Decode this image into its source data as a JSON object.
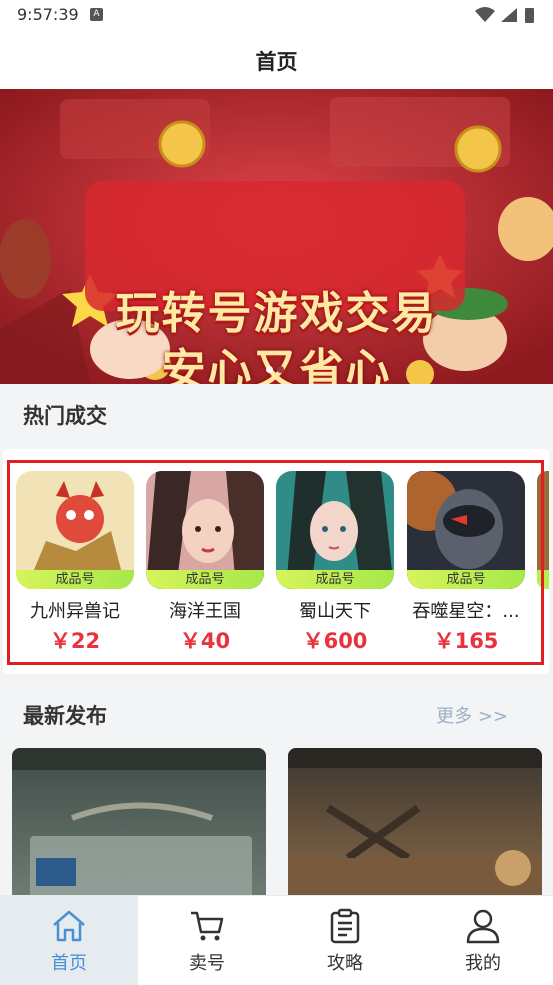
{
  "status_bar": {
    "time": "9:57:39",
    "notification_icon": "a-icon",
    "icons": [
      "wifi-icon",
      "signal-icon",
      "battery-icon"
    ]
  },
  "header": {
    "title": "首页"
  },
  "banner": {
    "line1": "玩转号游戏交易",
    "line2": "安心又省心",
    "dots_count": 2,
    "active_dot": 0
  },
  "hot_deals": {
    "title": "热门成交",
    "items": [
      {
        "tag": "成品号",
        "name": "九州异兽记",
        "price": "￥22"
      },
      {
        "tag": "成品号",
        "name": "海洋王国",
        "price": "￥40"
      },
      {
        "tag": "成品号",
        "name": "蜀山天下",
        "price": "￥600"
      },
      {
        "tag": "成品号",
        "name": "吞噬星空：...",
        "price": "￥165"
      }
    ]
  },
  "latest": {
    "title": "最新发布",
    "more": "更多 >>"
  },
  "nav": {
    "items": [
      {
        "label": "首页",
        "icon": "home-icon",
        "active": true
      },
      {
        "label": "卖号",
        "icon": "cart-icon",
        "active": false
      },
      {
        "label": "攻略",
        "icon": "clipboard-icon",
        "active": false
      },
      {
        "label": "我的",
        "icon": "user-icon",
        "active": false
      }
    ]
  },
  "colors": {
    "accent": "#4a8fd4",
    "price": "#e8333e",
    "highlight_frame": "#e02020",
    "tag_green": "#b9ec52"
  }
}
